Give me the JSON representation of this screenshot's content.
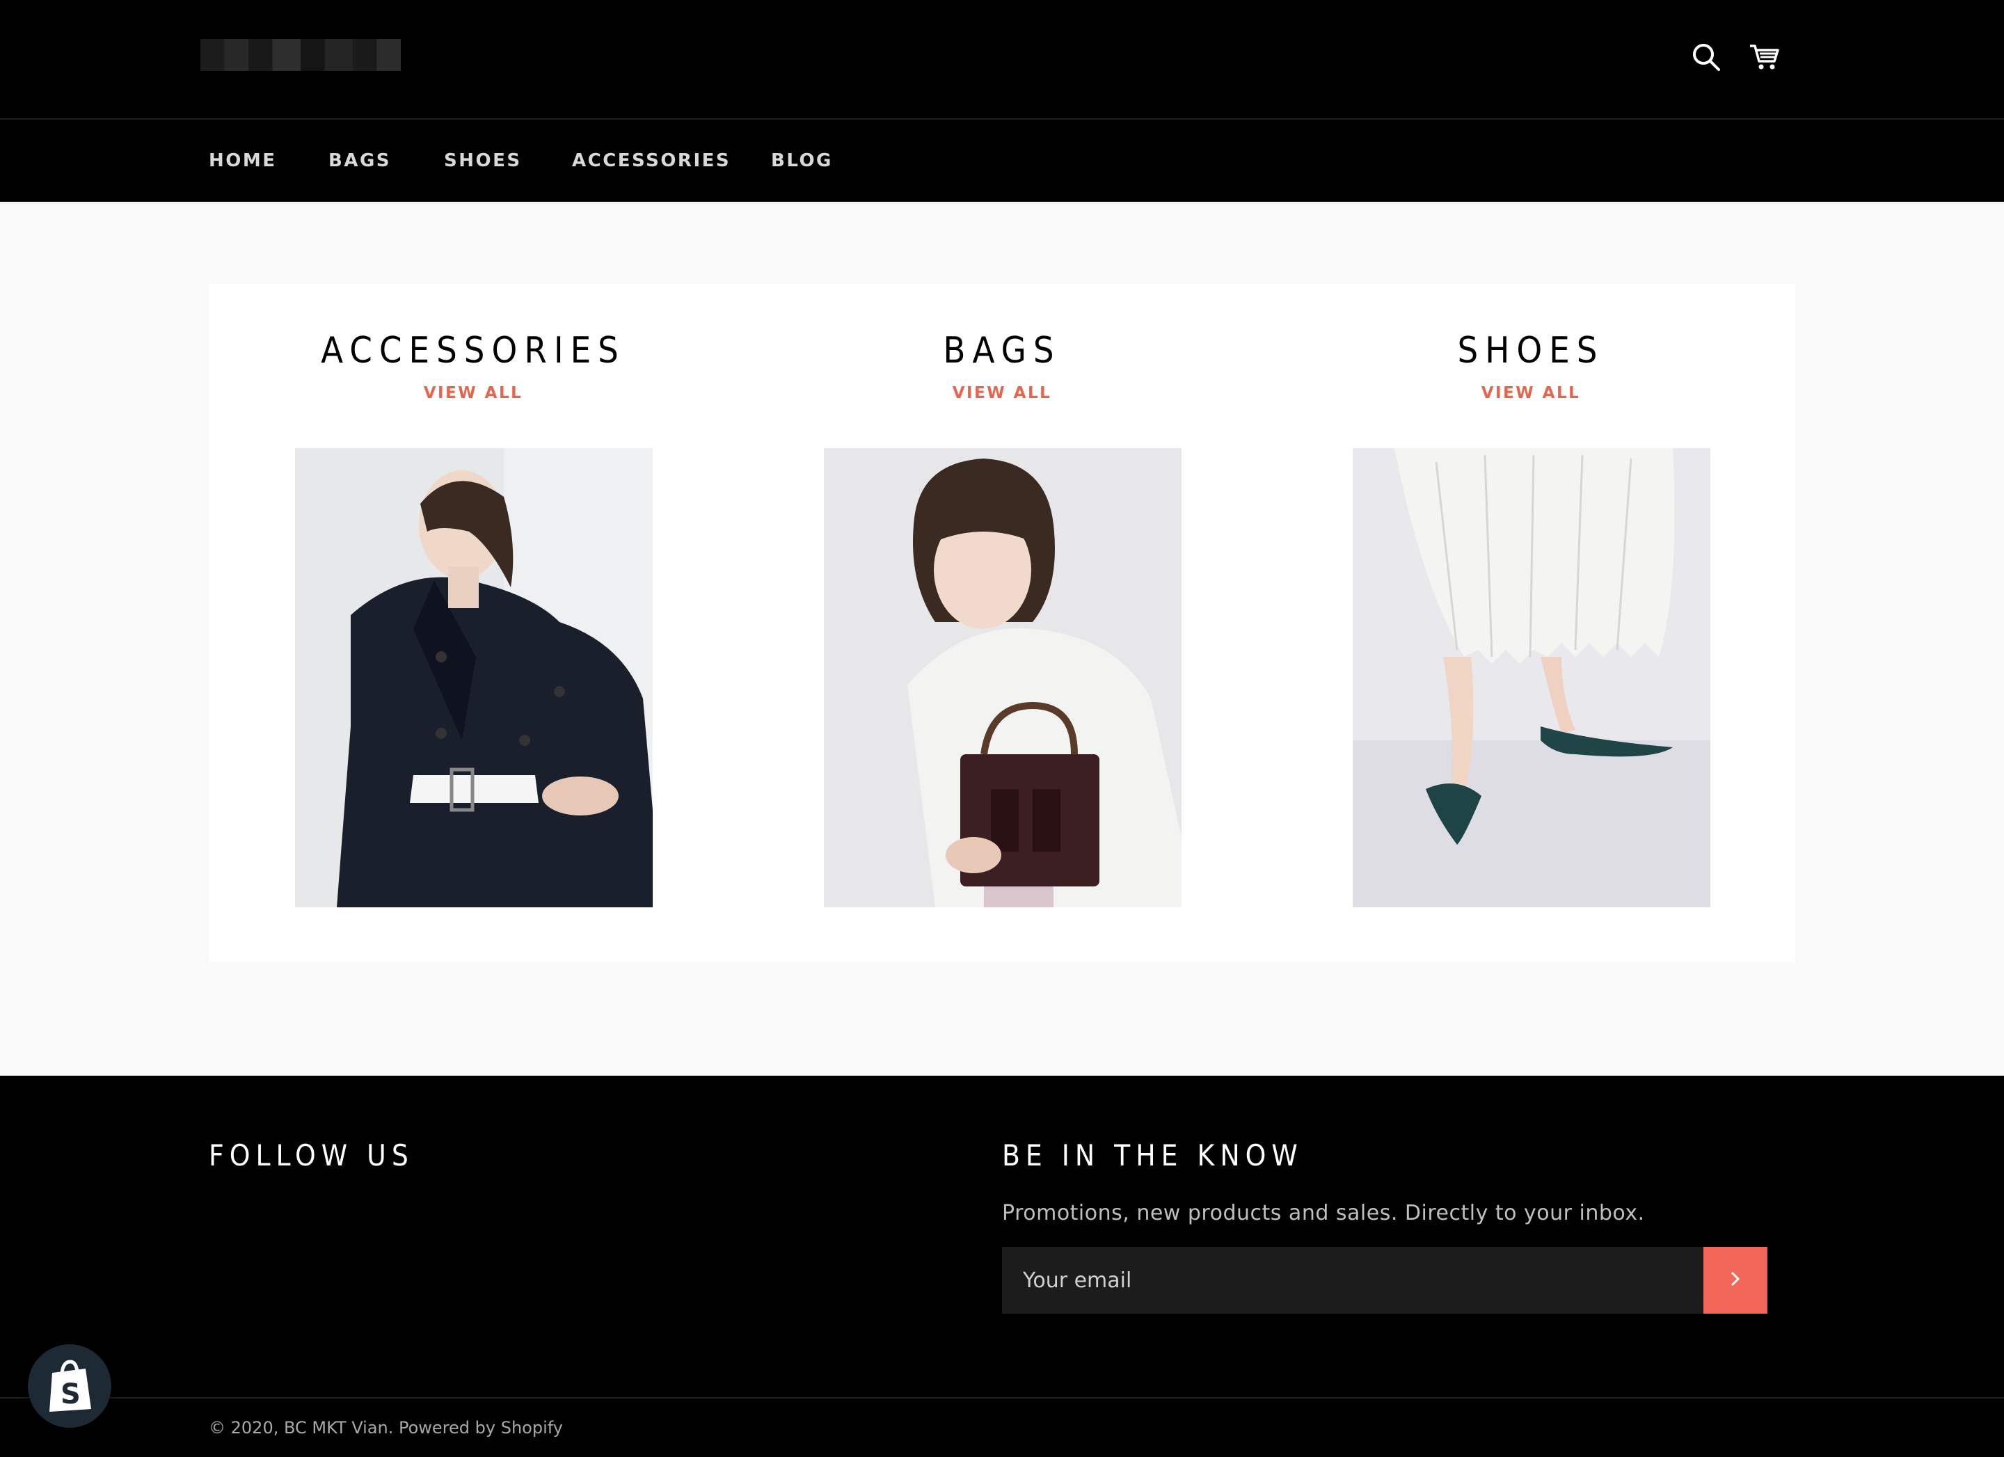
{
  "header": {
    "logo_alt": "",
    "icons": {
      "search": "search-icon",
      "cart": "cart-icon"
    }
  },
  "nav": {
    "items": [
      {
        "label": "HOME"
      },
      {
        "label": "BAGS"
      },
      {
        "label": "SHOES"
      },
      {
        "label": "ACCESSORIES"
      },
      {
        "label": "BLOG"
      }
    ]
  },
  "collections": [
    {
      "title": "ACCESSORIES",
      "link": "VIEW ALL"
    },
    {
      "title": "BAGS",
      "link": "VIEW ALL"
    },
    {
      "title": "SHOES",
      "link": "VIEW ALL"
    }
  ],
  "footer": {
    "follow_title": "FOLLOW US",
    "newsletter_title": "BE IN THE KNOW",
    "newsletter_text": "Promotions, new products and sales. Directly to your inbox.",
    "email_placeholder": "Your email",
    "copyright": "© 2020, BC MKT Vian. Powered by Shopify"
  },
  "colors": {
    "accent": "#e5654e",
    "button": "#f3675a",
    "background": "#f9f9f9",
    "header": "#000000"
  }
}
